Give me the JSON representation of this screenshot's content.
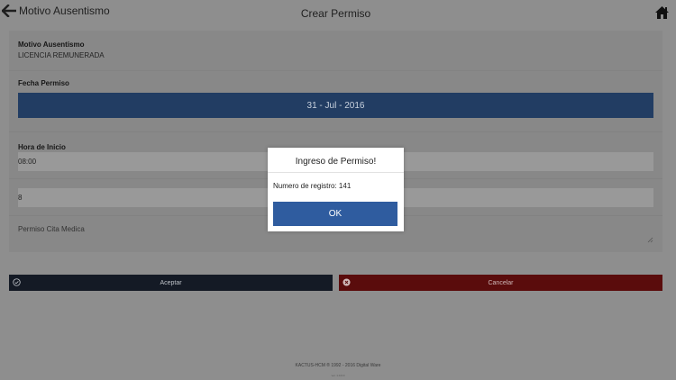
{
  "header": {
    "back_label": "Motivo Ausentismo",
    "title": "Crear Permiso",
    "back_icon": "arrow-left-icon",
    "home_icon": "home-icon"
  },
  "form": {
    "motivo_label": "Motivo Ausentismo",
    "motivo_value": "LICENCIA REMUNERADA",
    "fecha_label": "Fecha Permiso",
    "fecha_value": "31 - Jul - 2016",
    "hora_label": "Hora de Inicio",
    "hora_value": "08:00",
    "horas_value": "8",
    "observacion_value": "Permiso Cita Medica"
  },
  "actions": {
    "accept_label": "Aceptar",
    "cancel_label": "Cancelar"
  },
  "dialog": {
    "title": "Ingreso de Permiso!",
    "message": "Numero de registro: 141",
    "ok_label": "OK"
  },
  "footer": {
    "copyright": "KACTUS-HCM ® 1992 - 2016 Digital Ware",
    "version": "ver. 1.0.0.0"
  },
  "colors": {
    "date_button": "#223d63",
    "accept_button": "#141a25",
    "cancel_button": "#5a0c0c",
    "ok_button": "#2f5c9f"
  }
}
